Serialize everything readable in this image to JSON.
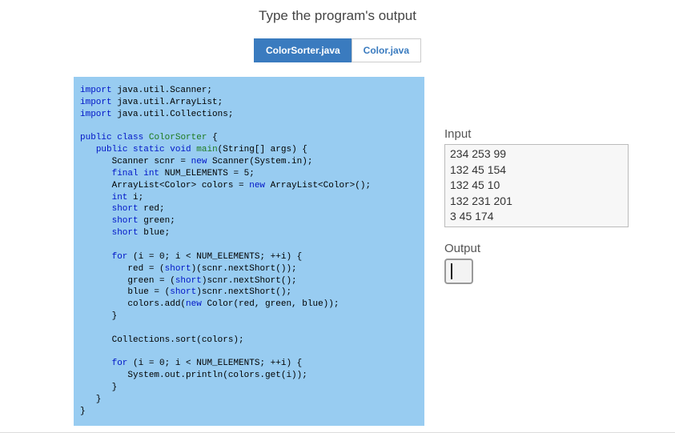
{
  "title": "Type the program's output",
  "tabs": [
    {
      "label": "ColorSorter.java",
      "active": true
    },
    {
      "label": "Color.java",
      "active": false
    }
  ],
  "code": {
    "l1a": "import",
    "l1b": " java.util.Scanner;",
    "l2a": "import",
    "l2b": " java.util.ArrayList;",
    "l3a": "import",
    "l3b": " java.util.Collections;",
    "l5a": "public",
    "l5b": "class",
    "l5c": "ColorSorter",
    "l5d": " {",
    "l6a": "public",
    "l6b": "static",
    "l6c": "void",
    "l6d": "main",
    "l6e": "(String[] args) {",
    "l7a": "      Scanner scnr = ",
    "l7b": "new",
    "l7c": " Scanner(System.in);",
    "l8a": "final",
    "l8b": "int",
    "l8c": " NUM_ELEMENTS = 5;",
    "l9a": "      ArrayList<Color> colors = ",
    "l9b": "new",
    "l9c": " ArrayList<Color>();",
    "l10a": "int",
    "l10b": " i;",
    "l11a": "short",
    "l11b": " red;",
    "l12a": "short",
    "l12b": " green;",
    "l13a": "short",
    "l13b": " blue;",
    "l15a": "for",
    "l15b": " (i = 0; i < NUM_ELEMENTS; ++i) {",
    "l16a": "         red = (",
    "l16b": "short",
    "l16c": ")(scnr.nextShort());",
    "l17a": "         green = (",
    "l17b": "short",
    "l17c": ")scnr.nextShort();",
    "l18a": "         blue = (",
    "l18b": "short",
    "l18c": ")scnr.nextShort();",
    "l19a": "         colors.add(",
    "l19b": "new",
    "l19c": " Color(red, green, blue));",
    "l20": "      }",
    "l22": "      Collections.sort(colors);",
    "l24a": "for",
    "l24b": " (i = 0; i < NUM_ELEMENTS; ++i) {",
    "l25": "         System.out.println(colors.get(i));",
    "l26": "      }",
    "l27": "   }",
    "l28": "}"
  },
  "input_label": "Input",
  "input_lines": [
    "234 253 99",
    "132 45 154",
    "132 45 10",
    "132 231 201",
    "3 45 174"
  ],
  "output_label": "Output",
  "output_value": ""
}
